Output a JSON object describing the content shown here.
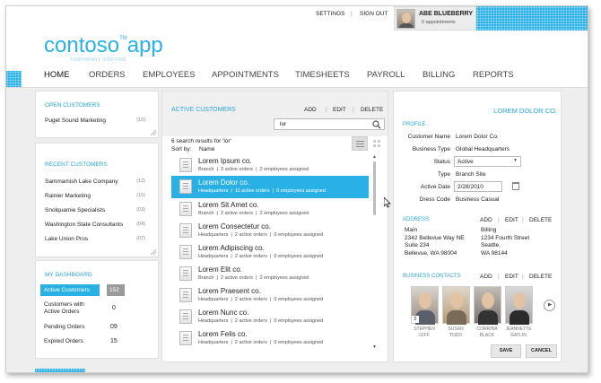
{
  "header": {
    "settings": "SETTINGS",
    "sep": "|",
    "signout": "SIGN OUT",
    "user_name": "ABE BLUEBERRY",
    "user_sub": "0 appointments"
  },
  "logo": {
    "name": "contoso",
    "tm": "TM",
    "app": "app",
    "tagline": "TEMPORARY STAFFING"
  },
  "nav": [
    "HOME",
    "ORDERS",
    "EMPLOYEES",
    "APPOINTMENTS",
    "TIMESHEETS",
    "PAYROLL",
    "BILLING",
    "REPORTS"
  ],
  "open_customers": {
    "title": "OPEN CUSTOMERS",
    "items": [
      {
        "name": "Puget Sound Marketing",
        "count": "(15)"
      }
    ]
  },
  "recent_customers": {
    "title": "RECENT CUSTOMERS",
    "items": [
      {
        "name": "Sammamish Lake Company",
        "count": "(12)"
      },
      {
        "name": "Rainier Marketing",
        "count": "(15)"
      },
      {
        "name": "Snolquamie Specialists",
        "count": "(03)"
      },
      {
        "name": "Washington  State Consultants",
        "count": "(04)"
      },
      {
        "name": "Lake Union Pros",
        "count": "(07)"
      }
    ]
  },
  "dashboard": {
    "title": "MY DASHBOARD",
    "items": [
      {
        "label": "Active Customers",
        "value": "152"
      },
      {
        "label": "Customers with Active Orders",
        "value": "0"
      },
      {
        "label": "Pending Orders",
        "value": "09"
      },
      {
        "label": "Expired Orders",
        "value": "15"
      }
    ]
  },
  "active_customers": {
    "title": "ACTIVE CUSTOMERS",
    "add": "ADD",
    "edit": "EDIT",
    "delete": "DELETE",
    "search_value": "lor",
    "results": "6 search results for 'lor'",
    "sort_label": "Sort by:",
    "sort_value": "Name",
    "rows": [
      {
        "name": "Lorem Ipsum co.",
        "type": "Branch",
        "orders": "3 active orders",
        "employees": "2 employees assigned"
      },
      {
        "name": "Lorem Dolor co.",
        "type": "Headquarters",
        "orders": "11 active orders",
        "employees": "0 employees assigned"
      },
      {
        "name": "Lorem Sit Amet co.",
        "type": "Branch",
        "orders": "2 active orders",
        "employees": "2 employees assigned"
      },
      {
        "name": "Lorem  Consectetur  co.",
        "type": "Headquarters",
        "orders": "2 active orders",
        "employees": "0 employees assigned"
      },
      {
        "name": "Lorem Adipiscing co.",
        "type": "Headquarters",
        "orders": "2 active orders",
        "employees": "0 employees assigned"
      },
      {
        "name": "Lorem Elit co.",
        "type": "Branch",
        "orders": "2 active orders",
        "employees": "2 employees assigned"
      },
      {
        "name": "Lorem Praesent co.",
        "type": "Headquarters",
        "orders": "2 active orders",
        "employees": "0 employees assigned"
      },
      {
        "name": "Lorem Nunc co.",
        "type": "Headquarters",
        "orders": "2 active orders",
        "employees": "0 employees assigned"
      },
      {
        "name": "Lorem Felis co.",
        "type": "Headquarters",
        "orders": "2 active orders",
        "employees": "0 employees assigned"
      }
    ],
    "selected": 1
  },
  "detail": {
    "title": "LOREM DOLOR CO.",
    "profile": "PROFILE",
    "fields": [
      {
        "label": "Customer Name",
        "value": "Lorem Dolor Co."
      },
      {
        "label": "Business Type",
        "value": "Global Headquarters"
      },
      {
        "label": "Status",
        "value": "Active"
      },
      {
        "label": "Type",
        "value": "Branch Site"
      },
      {
        "label": "Active Date",
        "value": "2/28/2010"
      },
      {
        "label": "Dress Code",
        "value": "Business Casual"
      }
    ],
    "address_title": "ADDRESS",
    "add": "ADD",
    "edit": "EDIT",
    "delete": "DELETE",
    "main_label": "Main",
    "main_lines": [
      "2342 Bellevue Way NE",
      "Suite 234",
      "Bellevue, WA 98004"
    ],
    "billing_label": "Billing",
    "billing_lines": [
      "1234 Fourth Street",
      "Seattle,",
      "WA 98144"
    ],
    "contacts_title": "BUSINESS CONTACTS",
    "contacts": [
      {
        "first": "STEPHEN",
        "last": "GIFF",
        "badge": "2"
      },
      {
        "first": "SUSAN",
        "last": "TODD",
        "badge": ""
      },
      {
        "first": "CORRINA",
        "last": "BLACK",
        "badge": ""
      },
      {
        "first": "JEANNETTE",
        "last": "GATLIN",
        "badge": ""
      }
    ],
    "save": "SAVE",
    "cancel": "CANCEL"
  },
  "colors": {
    "accent": "#29b1e6",
    "selected_row": "#29b1e6",
    "dashboard_highlight": "#29b1e6"
  }
}
